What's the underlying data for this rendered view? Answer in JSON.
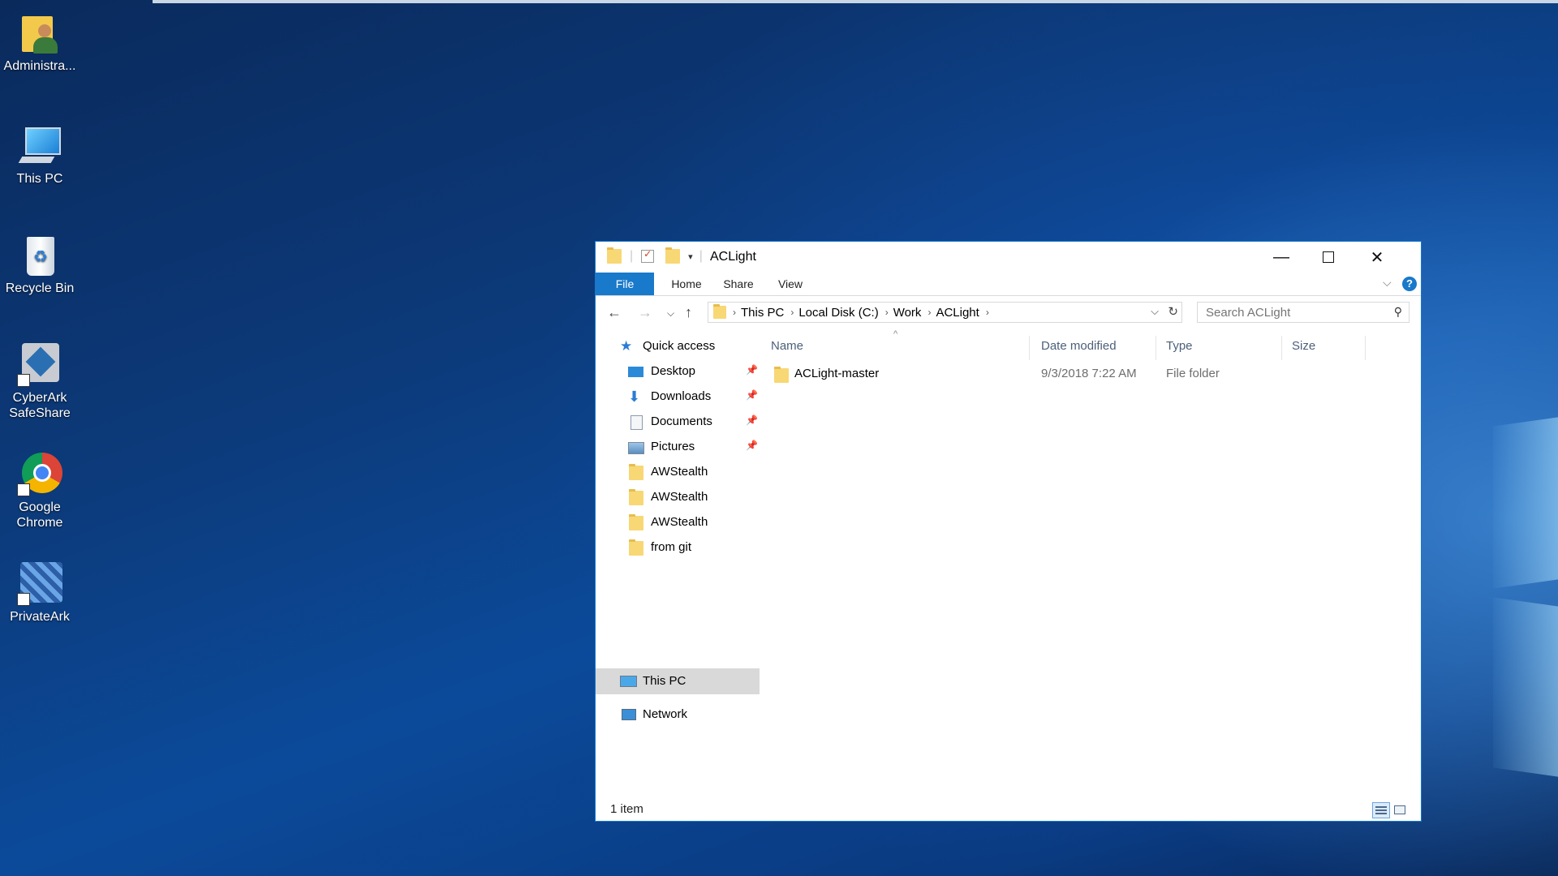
{
  "desktop": {
    "icons": [
      {
        "label": "Administra...",
        "icon": "user-folder-icon"
      },
      {
        "label": "This PC",
        "icon": "computer-icon"
      },
      {
        "label": "Recycle Bin",
        "icon": "recycle-bin-icon"
      },
      {
        "label": "CyberArk\nSafeShare",
        "line1": "CyberArk",
        "line2": "SafeShare",
        "icon": "cyberark-icon"
      },
      {
        "label": "Google\nChrome",
        "line1": "Google",
        "line2": "Chrome",
        "icon": "chrome-icon"
      },
      {
        "label": "PrivateArk",
        "icon": "privateark-icon"
      }
    ]
  },
  "window": {
    "title": "ACLight",
    "ribbon_tabs": [
      "File",
      "Home",
      "Share",
      "View"
    ],
    "breadcrumb": [
      "This PC",
      "Local Disk (C:)",
      "Work",
      "ACLight"
    ],
    "search_placeholder": "Search ACLight",
    "nav": {
      "quick_access": "Quick access",
      "pinned": [
        "Desktop",
        "Downloads",
        "Documents",
        "Pictures"
      ],
      "folders": [
        "AWStealth",
        "AWStealth",
        "AWStealth",
        "from git"
      ],
      "this_pc": "This PC",
      "network": "Network"
    },
    "columns": {
      "name": "Name",
      "date": "Date modified",
      "type": "Type",
      "size": "Size"
    },
    "rows": [
      {
        "name": "ACLight-master",
        "date": "9/3/2018 7:22 AM",
        "type": "File folder",
        "size": ""
      }
    ],
    "status": "1 item"
  },
  "colors": {
    "accent": "#1979ca",
    "selection": "#d9d9d9",
    "folder": "#f8d775"
  }
}
